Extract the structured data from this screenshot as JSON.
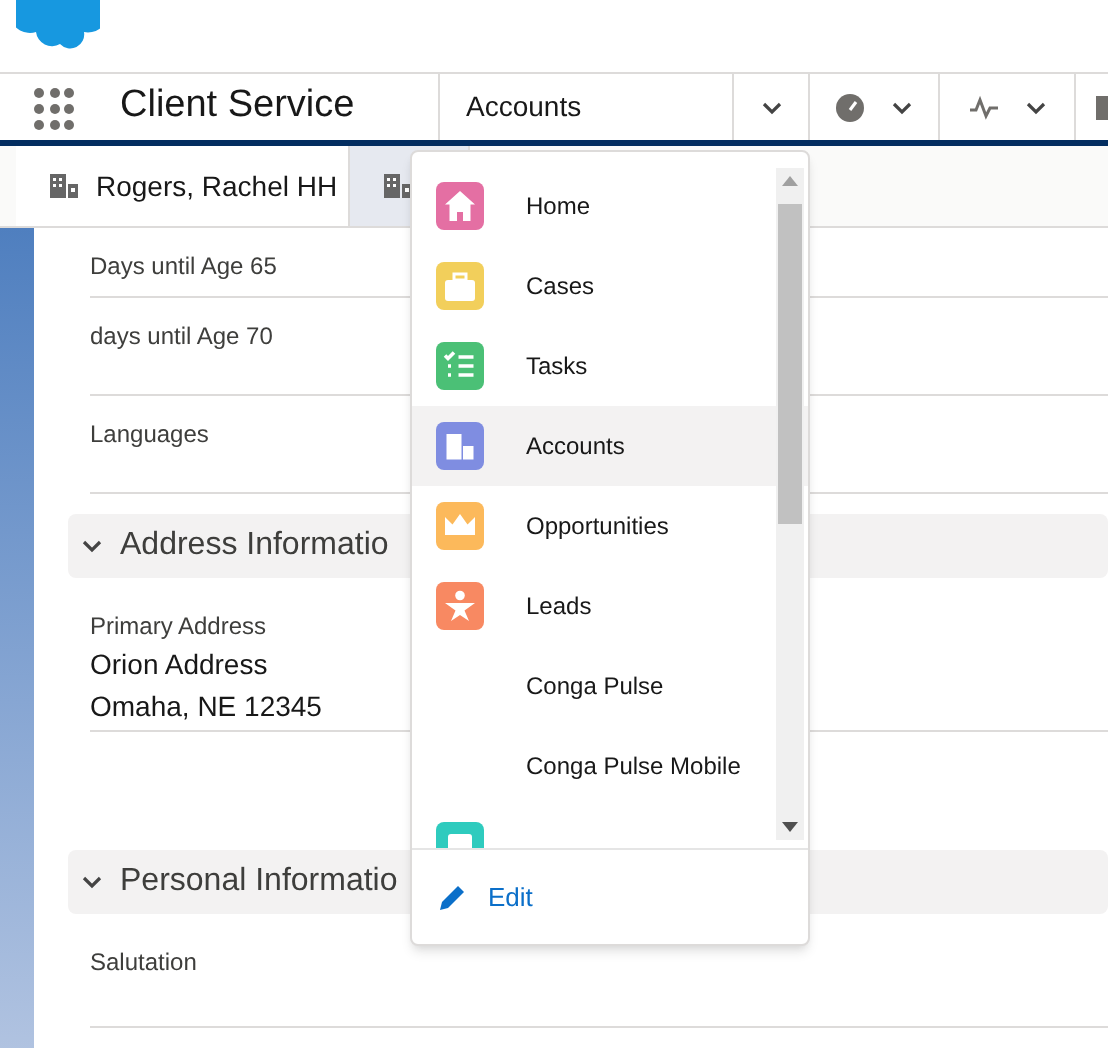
{
  "app_name": "Client Service",
  "nav_select": {
    "value": "Accounts",
    "expanded": true
  },
  "tabs": [
    {
      "label": "Rogers, Rachel HH",
      "selected": false
    },
    {
      "selected": true
    }
  ],
  "fields": [
    {
      "label": "Days until Age 65"
    },
    {
      "label": "days until Age 70"
    },
    {
      "label": "Languages"
    }
  ],
  "sections": [
    {
      "title": "Address Informatio",
      "expanded": true,
      "fields": [
        {
          "label": "Primary Address",
          "value_lines": [
            "Orion Address",
            "Omaha, NE 12345"
          ]
        }
      ]
    },
    {
      "title": "Personal Informatio",
      "expanded": true,
      "fields": [
        {
          "label": "Salutation"
        }
      ]
    }
  ],
  "menu": {
    "items": [
      {
        "kind": "home",
        "label": "Home",
        "selected": false
      },
      {
        "kind": "cases",
        "label": "Cases",
        "selected": false
      },
      {
        "kind": "tasks",
        "label": "Tasks",
        "selected": false
      },
      {
        "kind": "accounts",
        "label": "Accounts",
        "selected": true
      },
      {
        "kind": "opportunities",
        "label": "Opportunities",
        "selected": false
      },
      {
        "kind": "leads",
        "label": "Leads",
        "selected": false
      },
      {
        "kind": "plain",
        "label": "Conga Pulse",
        "selected": false
      },
      {
        "kind": "plain",
        "label": "Conga Pulse Mobile",
        "selected": false
      },
      {
        "kind": "reports",
        "selected": false
      }
    ],
    "edit_label": "Edit"
  }
}
